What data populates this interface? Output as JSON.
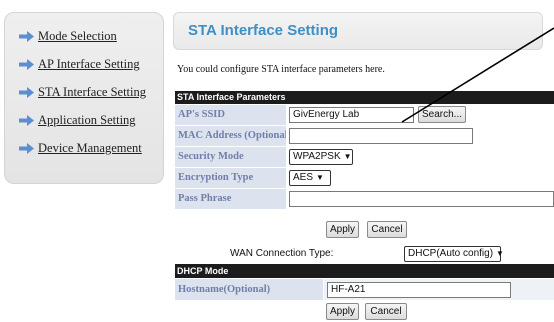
{
  "sidebar": {
    "items": [
      {
        "label": "Mode Selection",
        "icon": "arrow-right-icon"
      },
      {
        "label": "AP Interface Setting",
        "icon": "arrow-right-icon"
      },
      {
        "label": "STA Interface Setting",
        "icon": "arrow-right-icon"
      },
      {
        "label": "Application Setting",
        "icon": "arrow-right-icon"
      },
      {
        "label": "Device Management",
        "icon": "arrow-right-icon"
      }
    ]
  },
  "header": {
    "title": "STA Interface Setting"
  },
  "intro": "You could configure STA interface parameters here.",
  "sta_params": {
    "section_title": "STA Interface Parameters",
    "ssid_label": "AP's SSID",
    "ssid_value": "GivEnergy Lab",
    "search_label": "Search...",
    "mac_label": "MAC Address (Optional)",
    "mac_value": "",
    "security_label": "Security Mode",
    "security_value": "WPA2PSK",
    "encryption_label": "Encryption Type",
    "encryption_value": "AES",
    "passphrase_label": "Pass Phrase",
    "passphrase_value": "",
    "apply_label": "Apply",
    "cancel_label": "Cancel"
  },
  "wan": {
    "label": "WAN Connection Type:",
    "value": "DHCP(Auto config)"
  },
  "dhcp": {
    "section_title": "DHCP Mode",
    "hostname_label": "Hostname(Optional)",
    "hostname_value": "HF-A21",
    "apply_label": "Apply",
    "cancel_label": "Cancel"
  },
  "colors": {
    "accent": "#3f8fc2",
    "arrow": "#5b8fd0",
    "label_bg": "#dde3ee",
    "label_text": "#6f7fa8",
    "section_bg": "#1c1c1c"
  }
}
